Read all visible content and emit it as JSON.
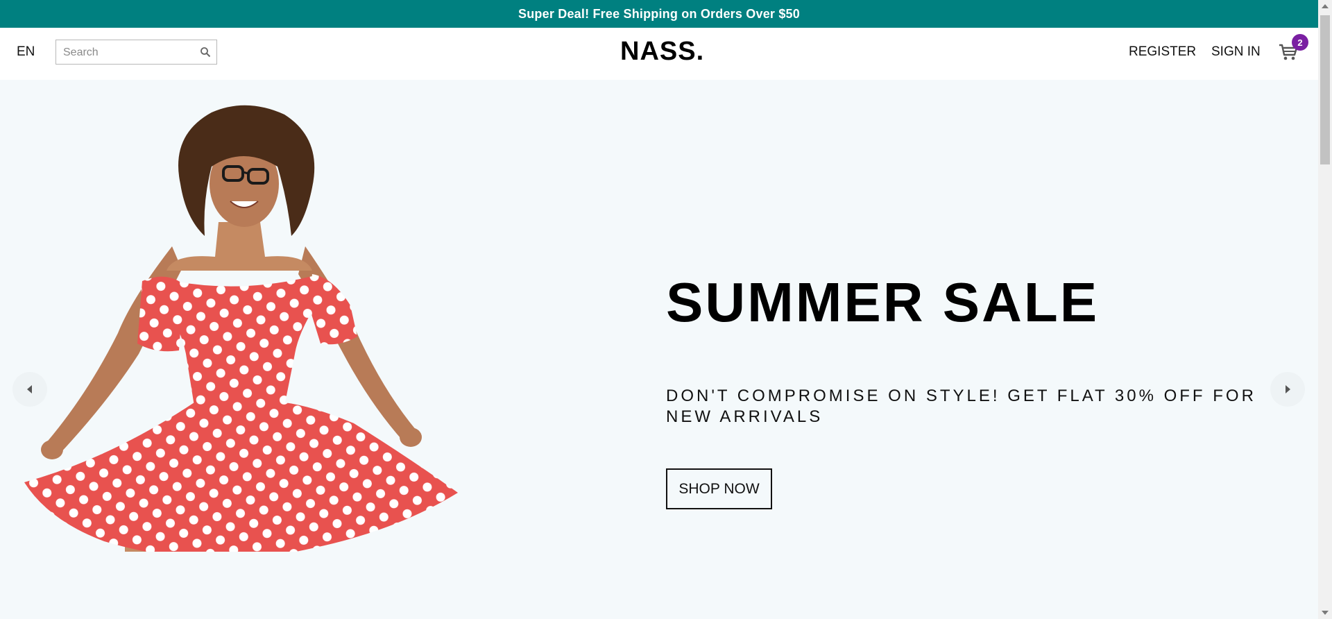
{
  "announcement": {
    "text": "Super Deal! Free Shipping on Orders Over $50"
  },
  "navbar": {
    "language": "EN",
    "search": {
      "placeholder": "Search",
      "value": ""
    },
    "logo": "NASS.",
    "links": {
      "register": "REGISTER",
      "sign_in": "SIGN IN"
    },
    "cart": {
      "icon": "cart-icon",
      "count": "2"
    }
  },
  "hero": {
    "title": "SUMMER SALE",
    "description": "DON'T COMPROMISE ON STYLE! GET FLAT 30% OFF FOR NEW ARRIVALS",
    "cta": "SHOP NOW",
    "image": "woman-in-polka-dot-dress",
    "arrows": {
      "left": "caret-left-icon",
      "right": "caret-right-icon"
    }
  },
  "colors": {
    "announcement_bg": "#008080",
    "badge_bg": "#7a1fa2",
    "hero_bg": "#f4f9fb",
    "dress": "#e8524f"
  }
}
